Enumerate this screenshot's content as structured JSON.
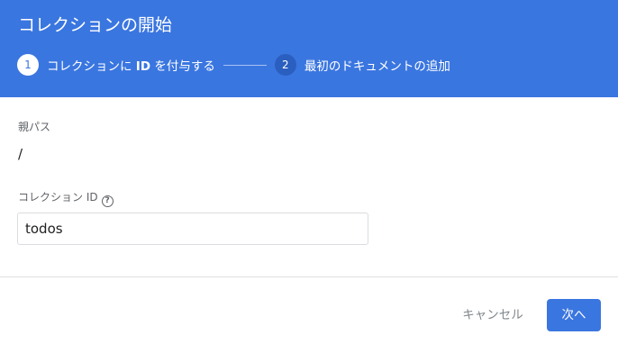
{
  "dialog": {
    "title": "コレクションの開始",
    "steps": [
      {
        "number": "1",
        "label_prefix": "コレクションに ",
        "label_bold": "ID",
        "label_suffix": " を付与する",
        "state": "active"
      },
      {
        "number": "2",
        "label": "最初のドキュメントの追加",
        "state": "inactive"
      }
    ]
  },
  "form": {
    "parent_path_label": "親パス",
    "parent_path_value": "/",
    "collection_id_label": "コレクション ID",
    "help_icon_glyph": "?",
    "collection_id_value": "todos"
  },
  "footer": {
    "cancel_label": "キャンセル",
    "next_label": "次へ"
  },
  "colors": {
    "header_bg": "#3a76e0",
    "primary_button": "#3a76e0",
    "cancel_text": "#80868b"
  },
  "icons": {
    "help": "help-circle-icon"
  }
}
